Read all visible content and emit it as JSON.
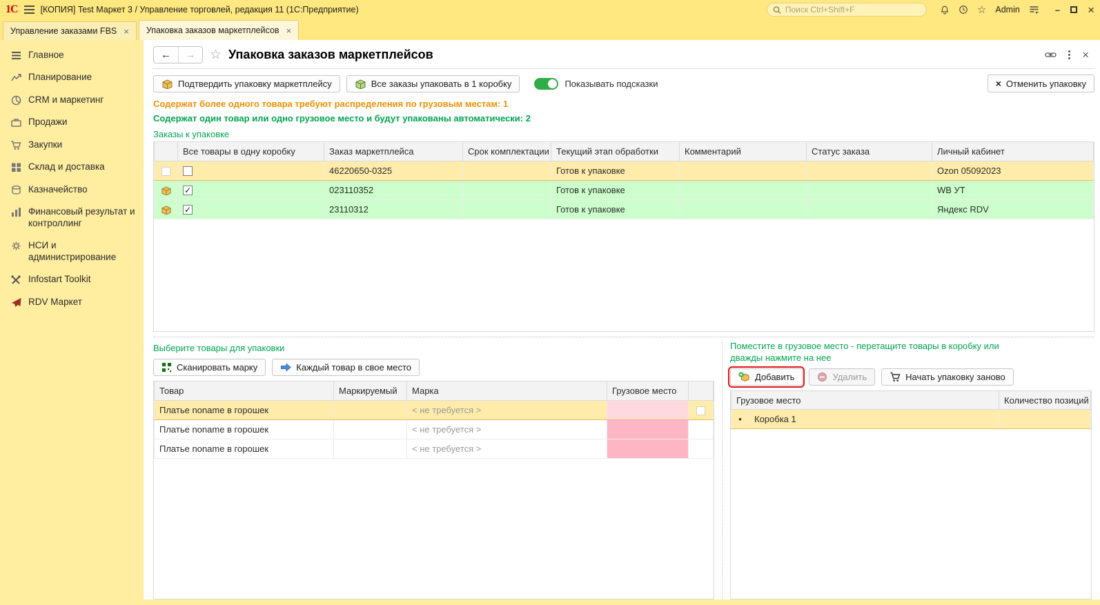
{
  "colors": {
    "accent_yellow": "#ffe87f",
    "sidebar_yellow": "#ffeda0",
    "green_text": "#00a550",
    "orange_text": "#ef9000",
    "row_green": "#ccffcc",
    "row_selected": "#ffecab",
    "cell_pink": "#ffb6c4",
    "toggle_on": "#2fae47",
    "highlight_red": "#e01515"
  },
  "icons": {
    "back_arrow": "←",
    "forward_arrow": "→",
    "star_outline": "☆",
    "close": "×",
    "minimize": "–",
    "check": "✓",
    "bullet": "•"
  },
  "titlebar": {
    "logo": "1С",
    "title": "[КОПИЯ] Test Маркет 3 / Управление торговлей, редакция 11  (1С:Предприятие)",
    "search_placeholder": "Поиск Ctrl+Shift+F",
    "user": "Admin"
  },
  "tabs": [
    {
      "label": "Управление заказами FBS"
    },
    {
      "label": "Упаковка заказов маркетплейсов"
    }
  ],
  "sidebar": {
    "items": [
      {
        "label": "Главное"
      },
      {
        "label": "Планирование"
      },
      {
        "label": "CRM и маркетинг"
      },
      {
        "label": "Продажи"
      },
      {
        "label": "Закупки"
      },
      {
        "label": "Склад и доставка"
      },
      {
        "label": "Казначейство"
      },
      {
        "label": "Финансовый результат и контроллинг"
      },
      {
        "label": "НСИ и администрирование"
      },
      {
        "label": "Infostart Toolkit"
      },
      {
        "label": "RDV Маркет"
      }
    ]
  },
  "page": {
    "title": "Упаковка заказов маркетплейсов",
    "toolbar": {
      "confirm": "Подтвердить упаковку маркетплейсу",
      "pack_all": "Все заказы упаковать в 1 коробку",
      "show_hints": "Показывать подсказки",
      "cancel": "Отменить упаковку"
    },
    "messages": {
      "orange": "Содержат более одного товара требуют распределения по грузовым местам: 1",
      "green": "Содержат один товар или одно грузовое место и будут упакованы автоматически: 2"
    },
    "orders": {
      "label": "Заказы к упаковке",
      "headers": {
        "all_in_one": "Все товары в одну коробку",
        "order": "Заказ маркетплейса",
        "deadline": "Срок комплектации",
        "stage": "Текущий этап обработки",
        "comment": "Комментарий",
        "status": "Статус заказа",
        "account": "Личный кабинет"
      },
      "rows": [
        {
          "check": "",
          "order": "46220650-0325",
          "deadline": "",
          "stage": "Готов к упаковке",
          "comment": "",
          "status": "",
          "account": "Ozon 05092023"
        },
        {
          "check": "✓",
          "order": "023110352",
          "deadline": "",
          "stage": "Готов к упаковке",
          "comment": "",
          "status": "",
          "account": "WB УТ"
        },
        {
          "check": "✓",
          "order": "23110312",
          "deadline": "",
          "stage": "Готов к упаковке",
          "comment": "",
          "status": "",
          "account": "Яндекс RDV"
        }
      ]
    },
    "products": {
      "label": "Выберите товары для упаковки",
      "scan_button": "Сканировать марку",
      "each_button": "Каждый товар в свое место",
      "headers": {
        "product": "Товар",
        "marked": "Маркируемый",
        "mark": "Марка",
        "package": "Грузовое место"
      },
      "rows": [
        {
          "product": "Платье noname в горошек",
          "marked": "",
          "mark": "< не требуется >",
          "package": ""
        },
        {
          "product": "Платье noname в горошек",
          "marked": "",
          "mark": "< не требуется >",
          "package": ""
        },
        {
          "product": "Платье noname в горошек",
          "marked": "",
          "mark": "< не требуется >",
          "package": ""
        }
      ]
    },
    "packages": {
      "hint_line1": "Поместите в грузовое место - перетащите товары в коробку или",
      "hint_line2": "дважды нажмите на нее",
      "add_button": "Добавить",
      "delete_button": "Удалить",
      "restart_button": "Начать упаковку заново",
      "headers": {
        "package": "Грузовое место",
        "count": "Количество позиций"
      },
      "rows": [
        {
          "bullet": "•",
          "package": "Коробка 1",
          "count": ""
        }
      ]
    }
  }
}
